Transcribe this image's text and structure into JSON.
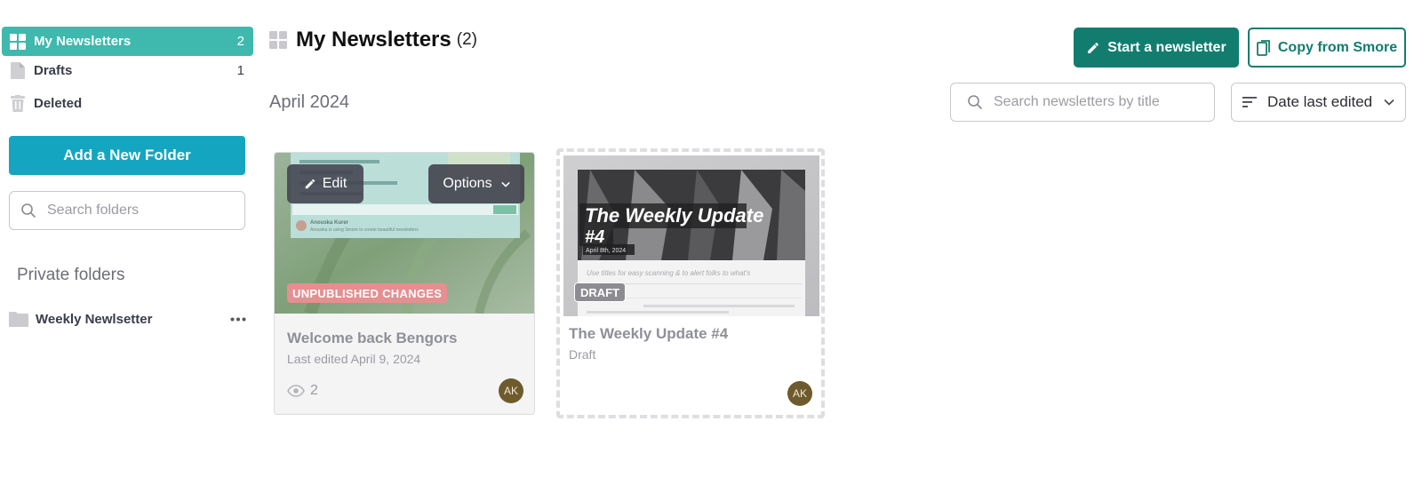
{
  "sidebar": {
    "items": [
      {
        "label": "My Newsletters",
        "count": "2",
        "icon": "grid-icon",
        "active": true
      },
      {
        "label": "Drafts",
        "count": "1",
        "icon": "document-icon"
      },
      {
        "label": "Deleted",
        "count": "",
        "icon": "trash-icon"
      }
    ],
    "add_folder_label": "Add a New Folder",
    "folder_search_placeholder": "Search folders",
    "private_heading": "Private folders",
    "folders": [
      {
        "label": "Weekly Newlsetter",
        "icon": "folder-icon"
      }
    ]
  },
  "header": {
    "title": "My Newsletters",
    "count": "(2)",
    "start_label": "Start a newsletter",
    "copy_label": "Copy from Smore"
  },
  "toolbar": {
    "month": "April 2024",
    "search_placeholder": "Search newsletters by title",
    "sort_label": "Date last edited"
  },
  "cards": [
    {
      "title": "Welcome back Bengors",
      "subtitle": "Last edited April 9, 2024",
      "badge": "UNPUBLISHED CHANGES",
      "views": "2",
      "avatar": "AK",
      "edit_label": "Edit",
      "options_label": "Options",
      "thumb_author": "Anouska Kurer",
      "thumb_tagline": "Anouska is using Smore to create beautiful newsletters"
    },
    {
      "title": "The Weekly Update #4",
      "subtitle": "Draft",
      "badge": "DRAFT",
      "avatar": "AK",
      "thumb_heading_1": "The Weekly Update",
      "thumb_heading_2": "#4",
      "thumb_date": "April 8th, 2024",
      "thumb_hint": "Use titles for easy scanning & to alert folks to what's"
    }
  ],
  "colors": {
    "teal_active": "#3fb8ad",
    "primary_green": "#127d6f",
    "folder_button": "#14a6c0",
    "badge_unpublished": "#e58f91",
    "avatar": "#6e5a2c"
  }
}
